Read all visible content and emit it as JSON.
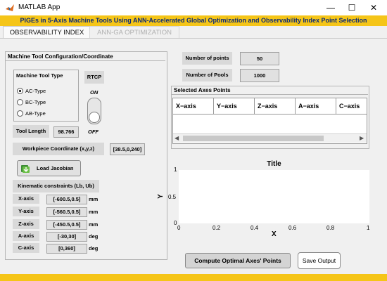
{
  "window": {
    "title": "MATLAB App",
    "minimize": "—",
    "maximize": "☐",
    "close": "✕"
  },
  "banner": "PIGEs in 5-Axis Machine Tools Using ANN-Accelerated Global Optimization and Observability Index Point Selection",
  "tabs": [
    {
      "label": "OBSERVABILITY INDEX"
    },
    {
      "label": "ANN-GA OPTIMIZATION"
    }
  ],
  "config": {
    "title": "Machine Tool Configuration/Coordinate",
    "type_title": "Machine Tool Type",
    "types": [
      "AC-Type",
      "BC-Type",
      "AB-Type"
    ],
    "selected_type": 0,
    "rtcp_title": "RTCP",
    "rtcp_on": "ON",
    "rtcp_off": "OFF",
    "tool_length_label": "Tool Length",
    "tool_length_value": "98.766",
    "workpiece_label": "Workpiece Coordinate (x,y,z)",
    "workpiece_value": "[38.5,0,240]",
    "load_jacobian": "Load Jacobian"
  },
  "kinematic": {
    "title": "Kinematic constraints (Lb, Ub)",
    "axes": [
      {
        "label": "X-axis",
        "value": "[-600.5,0.5]",
        "unit": "mm"
      },
      {
        "label": "Y-axis",
        "value": "[-560.5,0.5]",
        "unit": "mm"
      },
      {
        "label": "Z-axis",
        "value": "[-450.5,0.5]",
        "unit": "mm"
      },
      {
        "label": "A-axis",
        "value": "[-30,30]",
        "unit": "deg"
      },
      {
        "label": "C-axis",
        "value": "[0,360]",
        "unit": "deg"
      }
    ]
  },
  "points": {
    "label": "Number of points",
    "value": "50"
  },
  "pools": {
    "label": "Number of Pools",
    "value": "1000"
  },
  "table": {
    "title": "Selected Axes Points",
    "columns": [
      "X−axis",
      "Y−axis",
      "Z−axis",
      "A−axis",
      "C−axis"
    ]
  },
  "plot": {
    "title": "Title",
    "xlabel": "X",
    "ylabel": "Y",
    "xticks": [
      "0",
      "0.2",
      "0.4",
      "0.6",
      "0.8",
      "1"
    ],
    "yticks": [
      "0",
      "0.5",
      "1"
    ]
  },
  "actions": {
    "compute": "Compute Optimal Axes' Points",
    "save": "Save Output"
  }
}
